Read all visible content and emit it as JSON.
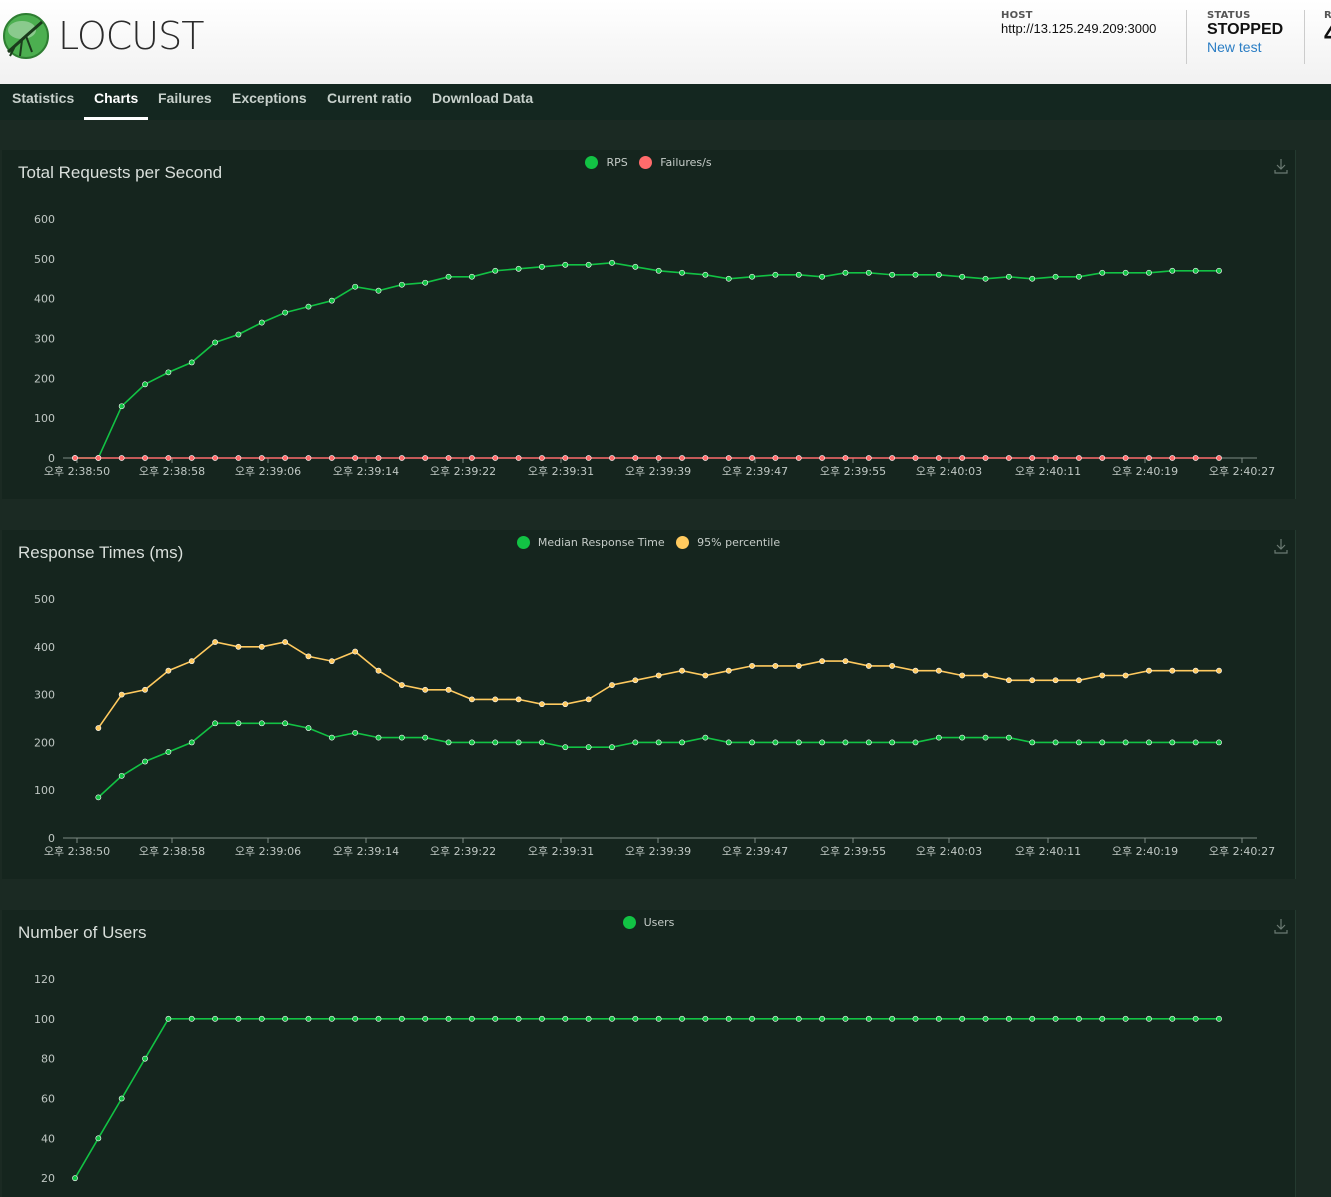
{
  "app": {
    "logo_text": "LOCUST"
  },
  "header": {
    "host_label": "HOST",
    "host_value": "http://13.125.249.209:3000",
    "status_label": "STATUS",
    "status_value": "STOPPED",
    "new_test_label": "New test",
    "rps_label": "R",
    "rps_value": "4"
  },
  "tabs": [
    {
      "label": "Statistics"
    },
    {
      "label": "Charts",
      "active": true
    },
    {
      "label": "Failures"
    },
    {
      "label": "Exceptions"
    },
    {
      "label": "Current ratio"
    },
    {
      "label": "Download Data"
    }
  ],
  "colors": {
    "green": "#12c244",
    "red": "#ff6b6b",
    "yellow": "#ffca5f"
  },
  "chart_data": [
    {
      "type": "line",
      "title": "Total Requests per Second",
      "ylim": [
        0,
        600
      ],
      "yticks": [
        0,
        100,
        200,
        300,
        400,
        500,
        600
      ],
      "x": [
        "오후 2:38:48",
        "오후 2:38:50",
        "오후 2:38:52",
        "오후 2:38:54",
        "오후 2:38:56",
        "오후 2:38:58",
        "오후 2:39:00",
        "오후 2:39:02",
        "오후 2:39:04",
        "오후 2:39:06",
        "오후 2:39:08",
        "오후 2:39:10",
        "오후 2:39:12",
        "오후 2:39:14",
        "오후 2:39:16",
        "오후 2:39:18",
        "오후 2:39:20",
        "오후 2:39:22",
        "오후 2:39:24",
        "오후 2:39:26",
        "오후 2:39:28",
        "오후 2:39:30",
        "오후 2:39:32",
        "오후 2:39:34",
        "오후 2:39:36",
        "오후 2:39:38",
        "오후 2:39:40",
        "오후 2:39:42",
        "오후 2:39:44",
        "오후 2:39:46",
        "오후 2:39:48",
        "오후 2:39:50",
        "오후 2:39:52",
        "오후 2:39:54",
        "오후 2:39:56",
        "오후 2:39:58",
        "오후 2:40:00",
        "오후 2:40:02",
        "오후 2:40:04",
        "오후 2:40:06",
        "오후 2:40:08",
        "오후 2:40:10",
        "오후 2:40:12",
        "오후 2:40:14",
        "오후 2:40:16",
        "오후 2:40:18",
        "오후 2:40:20",
        "오후 2:40:22",
        "오후 2:40:24",
        "오후 2:40:26"
      ],
      "xtick_labels": [
        "오후 2:38:50",
        "오후 2:38:58",
        "오후 2:39:06",
        "오후 2:39:14",
        "오후 2:39:22",
        "오후 2:39:31",
        "오후 2:39:39",
        "오후 2:39:47",
        "오후 2:39:55",
        "오후 2:40:03",
        "오후 2:40:11",
        "오후 2:40:19",
        "오후 2:40:27"
      ],
      "legend": [
        "RPS",
        "Failures/s"
      ],
      "series": [
        {
          "name": "RPS",
          "color": "#12c244",
          "values": [
            0,
            0,
            130,
            185,
            215,
            240,
            290,
            310,
            340,
            365,
            380,
            395,
            430,
            420,
            435,
            440,
            455,
            455,
            470,
            475,
            480,
            485,
            485,
            490,
            480,
            470,
            465,
            460,
            450,
            455,
            460,
            460,
            455,
            465,
            465,
            460,
            460,
            460,
            455,
            450,
            455,
            450,
            455,
            455,
            465,
            465,
            465,
            470,
            470,
            470
          ]
        },
        {
          "name": "Failures/s",
          "color": "#ff6b6b",
          "values": [
            0,
            0,
            0,
            0,
            0,
            0,
            0,
            0,
            0,
            0,
            0,
            0,
            0,
            0,
            0,
            0,
            0,
            0,
            0,
            0,
            0,
            0,
            0,
            0,
            0,
            0,
            0,
            0,
            0,
            0,
            0,
            0,
            0,
            0,
            0,
            0,
            0,
            0,
            0,
            0,
            0,
            0,
            0,
            0,
            0,
            0,
            0,
            0,
            0,
            0
          ]
        }
      ]
    },
    {
      "type": "line",
      "title": "Response Times (ms)",
      "ylim": [
        0,
        500
      ],
      "yticks": [
        0,
        100,
        200,
        300,
        400,
        500
      ],
      "xtick_labels": [
        "오후 2:38:50",
        "오후 2:38:58",
        "오후 2:39:06",
        "오후 2:39:14",
        "오후 2:39:22",
        "오후 2:39:31",
        "오후 2:39:39",
        "오후 2:39:47",
        "오후 2:39:55",
        "오후 2:40:03",
        "오후 2:40:11",
        "오후 2:40:19",
        "오후 2:40:27"
      ],
      "legend": [
        "Median Response Time",
        "95% percentile"
      ],
      "series": [
        {
          "name": "Median Response Time",
          "color": "#12c244",
          "values": [
            null,
            85,
            130,
            160,
            180,
            200,
            240,
            240,
            240,
            240,
            230,
            210,
            220,
            210,
            210,
            210,
            200,
            200,
            200,
            200,
            200,
            190,
            190,
            190,
            200,
            200,
            200,
            210,
            200,
            200,
            200,
            200,
            200,
            200,
            200,
            200,
            200,
            210,
            210,
            210,
            210,
            200,
            200,
            200,
            200,
            200,
            200,
            200,
            200,
            200
          ]
        },
        {
          "name": "95% percentile",
          "color": "#ffca5f",
          "values": [
            null,
            230,
            300,
            310,
            350,
            370,
            410,
            400,
            400,
            410,
            380,
            370,
            390,
            350,
            320,
            310,
            310,
            290,
            290,
            290,
            280,
            280,
            290,
            320,
            330,
            340,
            350,
            340,
            350,
            360,
            360,
            360,
            370,
            370,
            360,
            360,
            350,
            350,
            340,
            340,
            330,
            330,
            330,
            330,
            340,
            340,
            350,
            350,
            350,
            350
          ]
        }
      ]
    },
    {
      "type": "line",
      "title": "Number of Users",
      "ylim": [
        0,
        120
      ],
      "yticks": [
        20,
        40,
        60,
        80,
        100,
        120
      ],
      "legend": [
        "Users"
      ],
      "series": [
        {
          "name": "Users",
          "color": "#12c244",
          "values": [
            20,
            40,
            60,
            80,
            100,
            100,
            100,
            100,
            100,
            100,
            100,
            100,
            100,
            100,
            100,
            100,
            100,
            100,
            100,
            100,
            100,
            100,
            100,
            100,
            100,
            100,
            100,
            100,
            100,
            100,
            100,
            100,
            100,
            100,
            100,
            100,
            100,
            100,
            100,
            100,
            100,
            100,
            100,
            100,
            100,
            100,
            100,
            100,
            100,
            100
          ]
        }
      ]
    }
  ]
}
